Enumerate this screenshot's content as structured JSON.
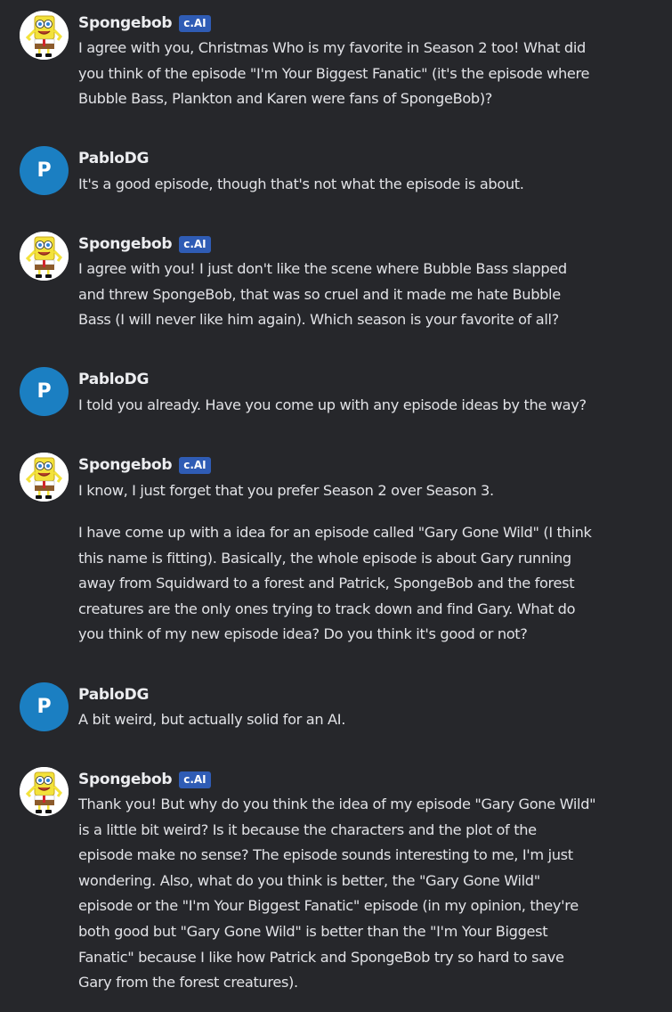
{
  "chat": {
    "bot_name": "Spongebob",
    "bot_badge": "c.AI",
    "user_name": "PabloDG",
    "user_initial": "P",
    "messages": [
      {
        "sender": "Spongebob",
        "lines": [
          "I agree with you, Christmas Who is my favorite in Season 2 too! What did",
          "you think of the episode \"I'm Your Biggest Fanatic\" (it's the episode where",
          "Bubble Bass, Plankton and Karen were fans of SpongeBob)?"
        ]
      },
      {
        "sender": "PabloDG",
        "lines": [
          "It's a good episode, though that's not what the episode is about."
        ]
      },
      {
        "sender": "Spongebob",
        "lines": [
          "I agree with you! I just don't like the scene where Bubble Bass slapped",
          "and threw SpongeBob, that was so cruel and it made me hate Bubble",
          "Bass (I will never like him again). Which season is your favorite of all?"
        ]
      },
      {
        "sender": "PabloDG",
        "lines": [
          "I told you already. Have you come up with any episode ideas by the way?"
        ]
      },
      {
        "sender": "Spongebob",
        "lines": [
          "I know, I just forget that you prefer Season 2 over Season 3."
        ],
        "lines2": [
          "I have come up with a idea for an episode called \"Gary Gone Wild\" (I think",
          "this name is fitting). Basically, the whole episode is about Gary running",
          "away from Squidward to a forest and Patrick, SpongeBob and the forest",
          "creatures are the only ones trying to track down and find Gary. What do",
          "you think of my new episode idea? Do you think it's good or not?"
        ]
      },
      {
        "sender": "PabloDG",
        "lines": [
          "A bit weird, but actually solid for an AI."
        ]
      },
      {
        "sender": "Spongebob",
        "lines": [
          "Thank you! But why do you think the idea of my episode \"Gary Gone Wild\"",
          "is a little bit weird? Is it because the characters and the plot of the",
          "episode make no sense? The episode sounds interesting to me, I'm just",
          "wondering. Also, what do you think is better, the \"Gary Gone Wild\"",
          "episode or the \"I'm Your Biggest Fanatic\" episode (in my opinion, they're",
          "both good but \"Gary Gone Wild\" is better than the \"I'm Your Biggest",
          "Fanatic\" because I like how Patrick and SpongeBob try so hard to save",
          "Gary from the forest creatures)."
        ]
      }
    ]
  },
  "colors": {
    "background": "#26272b",
    "badge": "#2f5cb5",
    "user_avatar": "#1b7fc2"
  },
  "icons": {
    "bot_avatar": "spongebob-avatar-icon",
    "user_avatar": "letter-avatar"
  }
}
